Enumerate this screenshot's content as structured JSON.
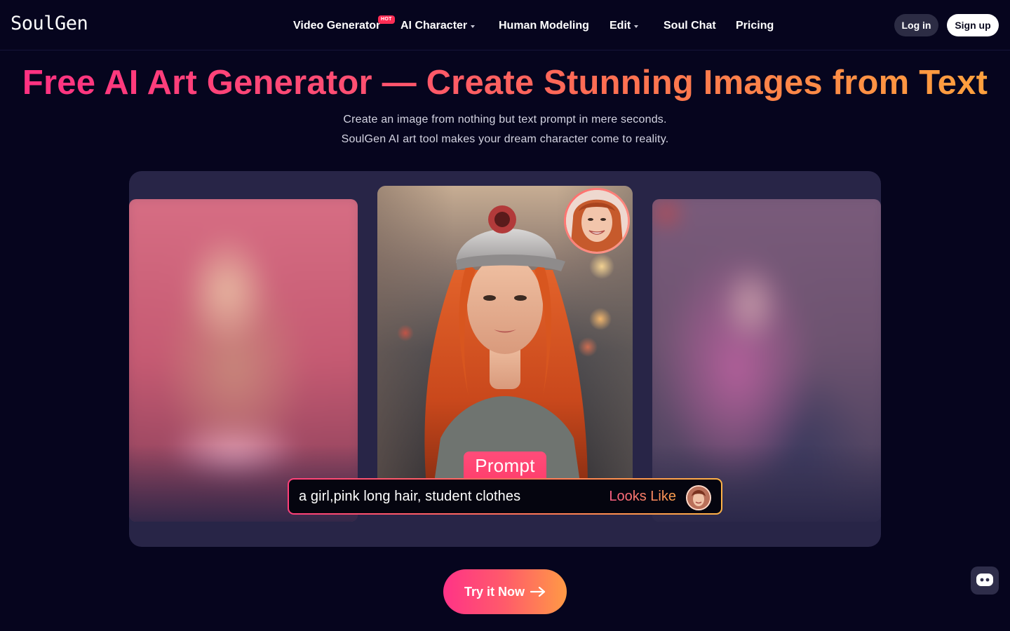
{
  "header": {
    "logo": "SoulGen",
    "nav": [
      {
        "label": "Video Generator",
        "badge": "HOT"
      },
      {
        "label": "AI Character",
        "dropdown": true
      },
      {
        "label": "Human Modeling"
      },
      {
        "label": "Edit",
        "dropdown": true
      },
      {
        "label": "Soul Chat"
      },
      {
        "label": "Pricing"
      }
    ],
    "login_label": "Log in",
    "signup_label": "Sign up"
  },
  "hero": {
    "headline": "Free AI Art Generator — Create Stunning Images from Text",
    "subtitle_line1": "Create an image from nothing but text prompt in mere seconds.",
    "subtitle_line2": "SoulGen AI art tool makes your dream character come to reality."
  },
  "showcase": {
    "prompt_label": "Prompt",
    "prompt_text": "a girl,pink long hair, student clothes",
    "looks_like_label": "Looks Like"
  },
  "cta": {
    "label": "Try it Now"
  },
  "icons": {
    "cta_arrow": "arrow-right-icon",
    "chat": "chat-bot-icon"
  },
  "colors": {
    "background": "#06051e",
    "accent_pink": "#ff2f83",
    "accent_orange": "#ffa43c",
    "hot_badge": "#ff2d55",
    "showcase_panel": "#282547"
  }
}
